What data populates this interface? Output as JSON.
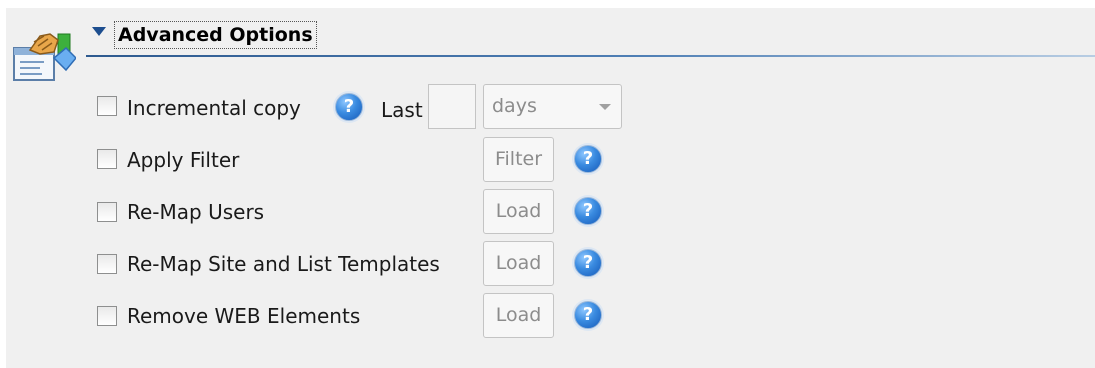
{
  "section": {
    "title": "Advanced Options",
    "icon": "options-icon",
    "collapse_icon": "triangle-down-icon"
  },
  "options": [
    {
      "label": "Incremental copy",
      "checked": false
    },
    {
      "label": "Apply Filter",
      "checked": false,
      "button": "Filter"
    },
    {
      "label": "Re-Map Users",
      "checked": false,
      "button": "Load"
    },
    {
      "label": "Re-Map Site and List Templates",
      "checked": false,
      "button": "Load"
    },
    {
      "label": "Remove WEB Elements",
      "checked": false,
      "button": "Load"
    }
  ],
  "incremental": {
    "last_label": "Last",
    "last_value": "",
    "unit": "days"
  },
  "help_icon": {
    "glyph": "?",
    "name": "help-icon"
  },
  "colors": {
    "background": "#f0f0f0",
    "accent": "#1d4e8f",
    "help_blue": "#2f7fd8",
    "disabled_text": "#8c8c8c"
  }
}
